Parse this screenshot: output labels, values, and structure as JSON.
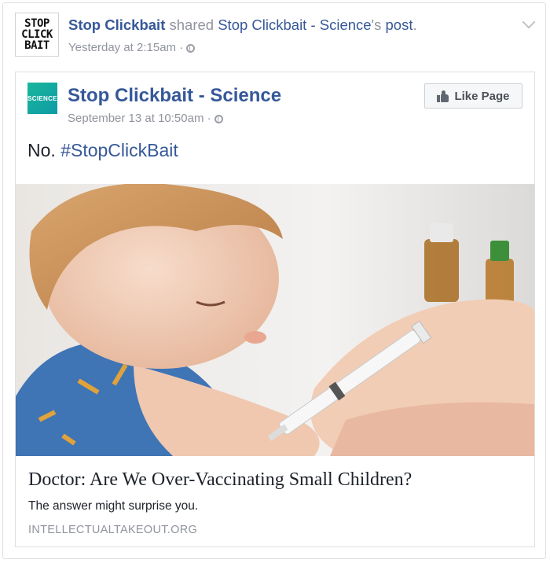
{
  "share_header": {
    "logo_lines": [
      "STOP",
      "CLICK",
      "BAIT"
    ],
    "sharer_name": "Stop Clickbait",
    "shared_word": " shared ",
    "source_name": "Stop Clickbait - Science",
    "possessive": "'s ",
    "post_word": "post",
    "period": ".",
    "timestamp": "Yesterday at 2:15am",
    "separator": " · "
  },
  "original_post": {
    "logo_text": "SCIENCE",
    "page_name": "Stop Clickbait - Science",
    "timestamp": "September 13 at 10:50am",
    "separator": " · ",
    "like_button_label": "Like Page",
    "text_prefix": "No. ",
    "hashtag": "#StopClickBait"
  },
  "link_preview": {
    "image_icon": "child-vaccination-photo",
    "title": "Doctor: Are We Over-Vaccinating Small Children?",
    "description": "The answer might surprise you.",
    "domain": "INTELLECTUALTAKEOUT.ORG"
  },
  "colors": {
    "link_blue": "#365899",
    "meta_gray": "#90949c",
    "text_dark": "#1d2129",
    "border": "#dddfe2"
  }
}
